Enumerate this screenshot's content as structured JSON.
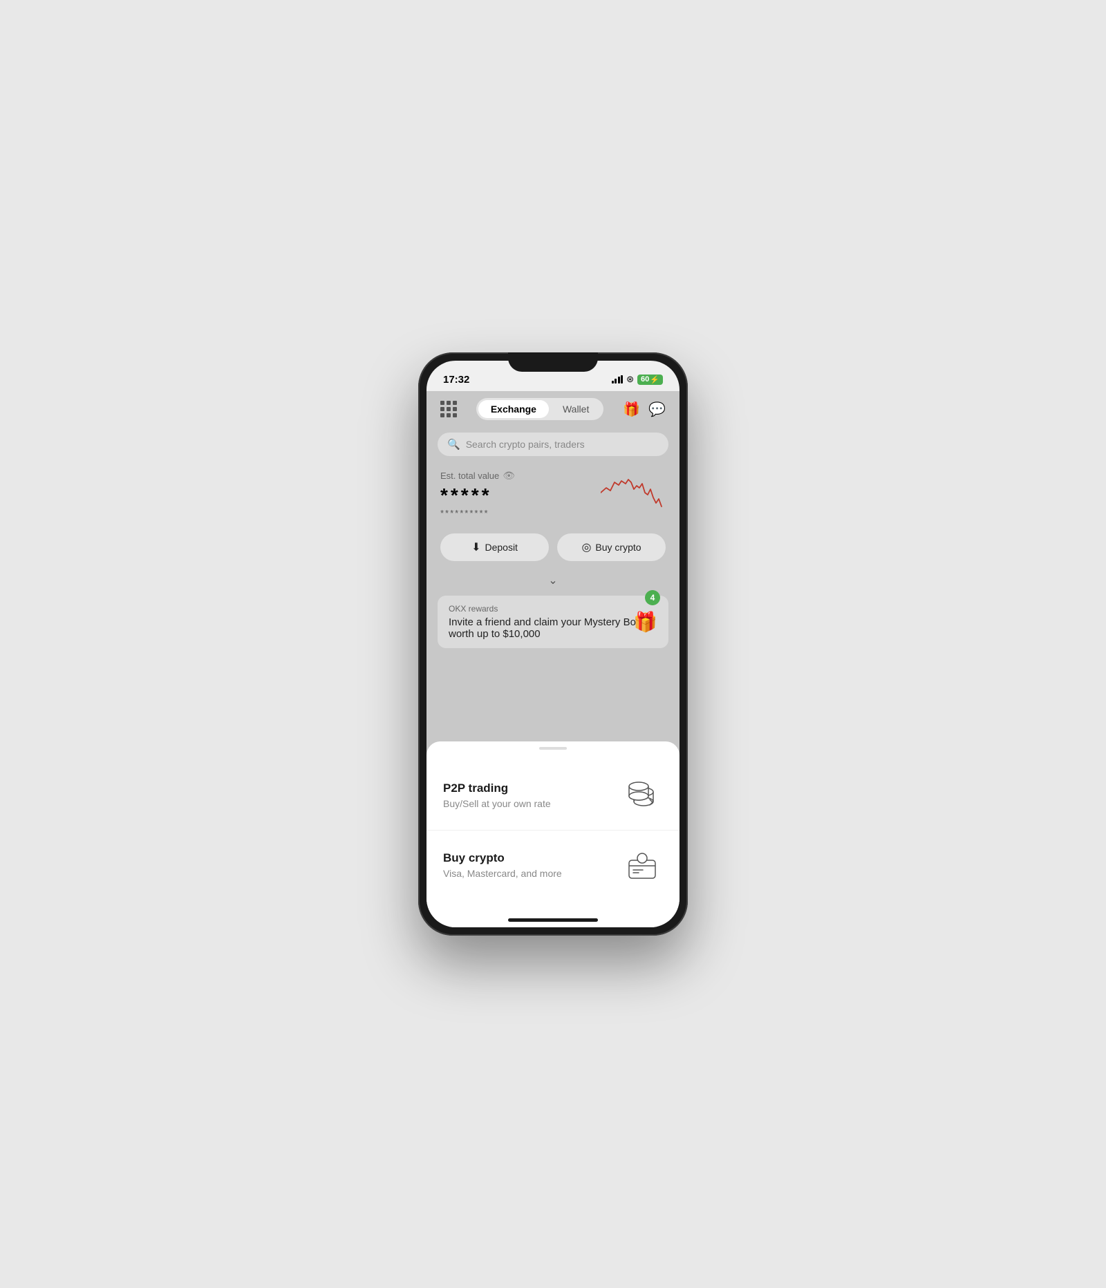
{
  "statusBar": {
    "time": "17:32",
    "battery": "60",
    "batteryBolt": "⚡"
  },
  "header": {
    "tab_exchange": "Exchange",
    "tab_wallet": "Wallet"
  },
  "search": {
    "placeholder": "Search crypto pairs, traders"
  },
  "balance": {
    "est_label": "Est. total value",
    "stars_large": "*****",
    "stars_small": "**********"
  },
  "buttons": {
    "deposit": "Deposit",
    "buy_crypto": "Buy crypto"
  },
  "rewards": {
    "label": "OKX rewards",
    "title": "Invite a friend and claim your Mystery Box worth up to $10,000",
    "badge": "4"
  },
  "bottomSheet": {
    "items": [
      {
        "title": "P2P trading",
        "subtitle": "Buy/Sell at your own rate",
        "icon_type": "coins"
      },
      {
        "title": "Buy crypto",
        "subtitle": "Visa, Mastercard, and more",
        "icon_type": "wallet"
      }
    ]
  }
}
